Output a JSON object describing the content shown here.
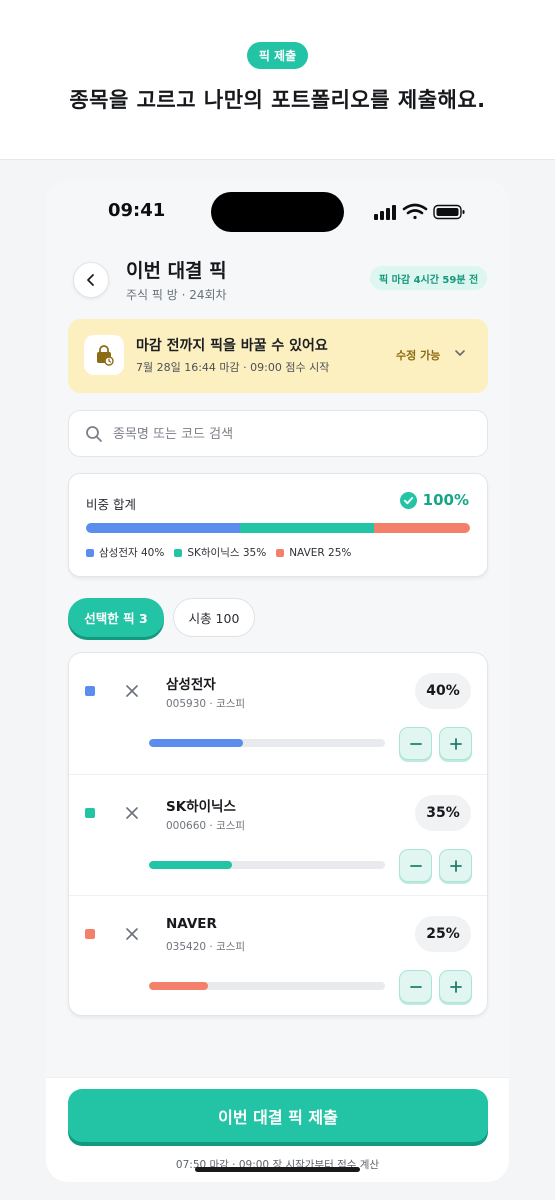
{
  "banner": {
    "badge": "픽 제출",
    "headline": "종목을 고르고 나만의 포트폴리오를 제출해요."
  },
  "status_bar": {
    "time": "09:41",
    "icons": [
      "signal-icon",
      "wifi-icon",
      "battery-icon"
    ]
  },
  "header": {
    "title": "이번 대결 픽",
    "subtitle": "주식 픽 방 · 24회차",
    "deadline_badge": "픽 마감 4시간 59분 전"
  },
  "notice": {
    "title": "마감 전까지 픽을 바꿀 수 있어요",
    "subtitle": "7월 28일 16:44 마감 · 09:00 점수 시작",
    "action": "수정 가능"
  },
  "search": {
    "placeholder": "종목명 또는 코드 검색",
    "value": ""
  },
  "weight_summary": {
    "label": "비중 합계",
    "total": "100%",
    "legend": [
      {
        "label": "삼성전자 40%",
        "value": 40,
        "color": "#5b8def"
      },
      {
        "label": "SK하이닉스 35%",
        "value": 35,
        "color": "#22c4a5"
      },
      {
        "label": "NAVER 25%",
        "value": 25,
        "color": "#f4806b"
      }
    ]
  },
  "filters": {
    "selected_label": "선택한 픽 3",
    "cap_label": "시총 100"
  },
  "picks": [
    {
      "name": "삼성전자",
      "meta": "005930 · 코스피",
      "percent": "40%",
      "weight": 40,
      "color": "#5b8def"
    },
    {
      "name": "SK하이닉스",
      "meta": "000660 · 코스피",
      "percent": "35%",
      "weight": 35,
      "color": "#22c4a5"
    },
    {
      "name": "NAVER",
      "meta": "035420 · 코스피",
      "percent": "25%",
      "weight": 25,
      "color": "#f4806b"
    }
  ],
  "submit": {
    "label": "이번 대결 픽 제출",
    "footnote": "07:50 마감 · 09:00 장 시작가부터 점수 계산"
  },
  "colors": {
    "accent": "#22c4a5",
    "notice_bg": "#fcefc0",
    "page_bg": "#f4f5f7"
  }
}
